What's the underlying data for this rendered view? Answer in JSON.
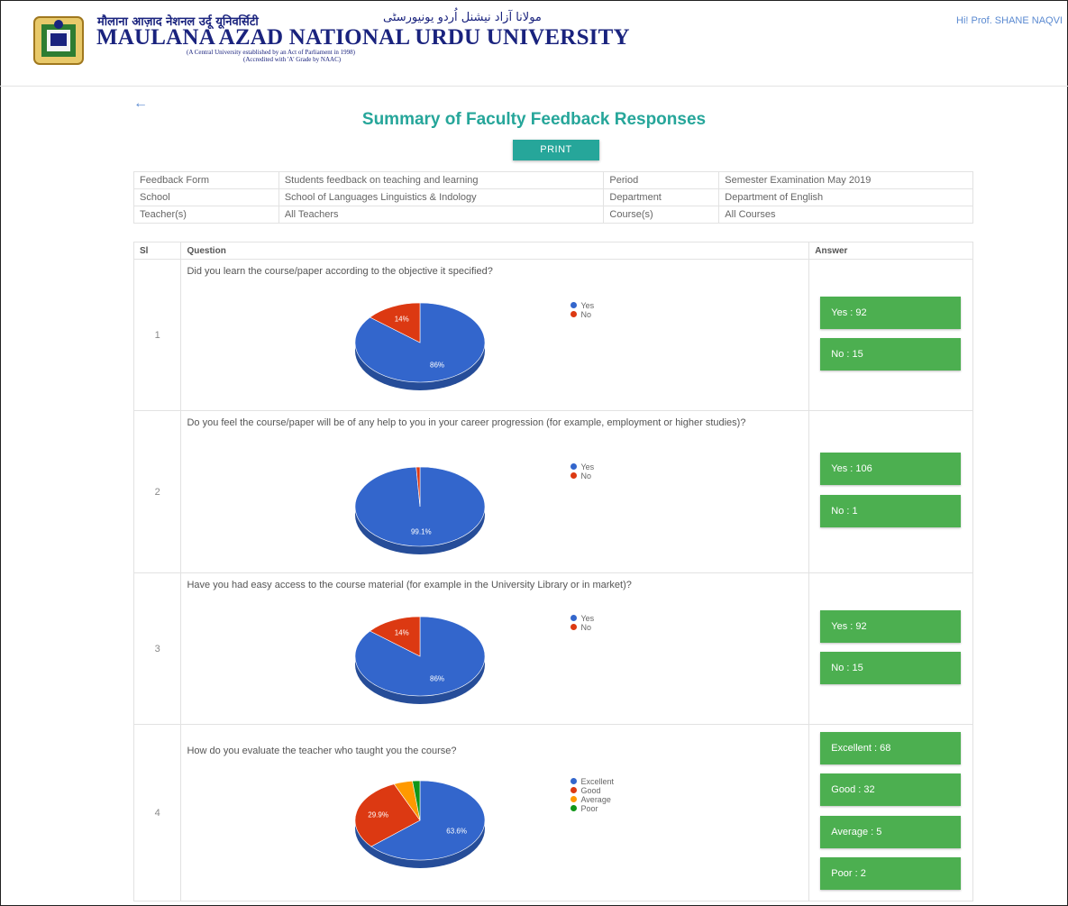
{
  "header": {
    "hindi_name": "मौलाना आज़ाद नेशनल उर्दू यूनिवर्सिटी",
    "urdu_name": "مولانا آزاد نیشنل اُردو یونیورسٹی",
    "university_name": "MAULANA AZAD NATIONAL URDU UNIVERSITY",
    "tagline_1": "(A Central University established by an Act of Parliament in 1998)",
    "tagline_2": "(Accredited with 'A' Grade by NAAC)",
    "greeting": "Hi! Prof. SHANE NAQVI"
  },
  "page": {
    "back_icon": "back-arrow-icon",
    "title": "Summary of Faculty Feedback Responses",
    "print_label": "PRINT"
  },
  "info": {
    "feedback_form_label": "Feedback Form",
    "feedback_form_value": "Students feedback on teaching and learning",
    "period_label": "Period",
    "period_value": "Semester Examination May 2019",
    "school_label": "School",
    "school_value": "School of Languages Linguistics & Indology",
    "department_label": "Department",
    "department_value": "Department of English",
    "teacher_label": "Teacher(s)",
    "teacher_value": "All Teachers",
    "course_label": "Course(s)",
    "course_value": "All Courses"
  },
  "table": {
    "col_sl": "Sl",
    "col_question": "Question",
    "col_answer": "Answer"
  },
  "colors": {
    "yes": "#3366cc",
    "no": "#dc3912",
    "excellent": "#3366cc",
    "good": "#dc3912",
    "average": "#ff9900",
    "poor": "#109618",
    "accent": "#26a69a",
    "answer": "#4caf50"
  },
  "questions": [
    {
      "sl": "1",
      "text": "Did you learn the course/paper according to the objective it specified?",
      "legend": [
        "Yes",
        "No"
      ],
      "answers": [
        "Yes : 92",
        "No : 15"
      ]
    },
    {
      "sl": "2",
      "text": "Do you feel the course/paper will be of any help to you in your career progression (for example, employment or higher studies)?",
      "legend": [
        "Yes",
        "No"
      ],
      "answers": [
        "Yes : 106",
        "No : 1"
      ]
    },
    {
      "sl": "3",
      "text": "Have you had easy access to the course material (for example in the University Library or in market)?",
      "legend": [
        "Yes",
        "No"
      ],
      "answers": [
        "Yes : 92",
        "No : 15"
      ]
    },
    {
      "sl": "4",
      "text": "How do you evaluate the teacher who taught you the course?",
      "legend": [
        "Excellent",
        "Good",
        "Average",
        "Poor"
      ],
      "answers": [
        "Excellent : 68",
        "Good : 32",
        "Average : 5",
        "Poor : 2"
      ]
    }
  ],
  "chart_data": [
    {
      "type": "pie",
      "labels": [
        "Yes",
        "No"
      ],
      "values": [
        92,
        15
      ],
      "slice_labels": [
        "86%",
        "14%"
      ]
    },
    {
      "type": "pie",
      "labels": [
        "Yes",
        "No"
      ],
      "values": [
        106,
        1
      ],
      "slice_labels": [
        "99.1%",
        ""
      ]
    },
    {
      "type": "pie",
      "labels": [
        "Yes",
        "No"
      ],
      "values": [
        92,
        15
      ],
      "slice_labels": [
        "86%",
        "14%"
      ]
    },
    {
      "type": "pie",
      "labels": [
        "Excellent",
        "Good",
        "Average",
        "Poor"
      ],
      "values": [
        68,
        32,
        5,
        2
      ],
      "slice_labels": [
        "63.6%",
        "29.9%",
        "",
        ""
      ]
    }
  ]
}
